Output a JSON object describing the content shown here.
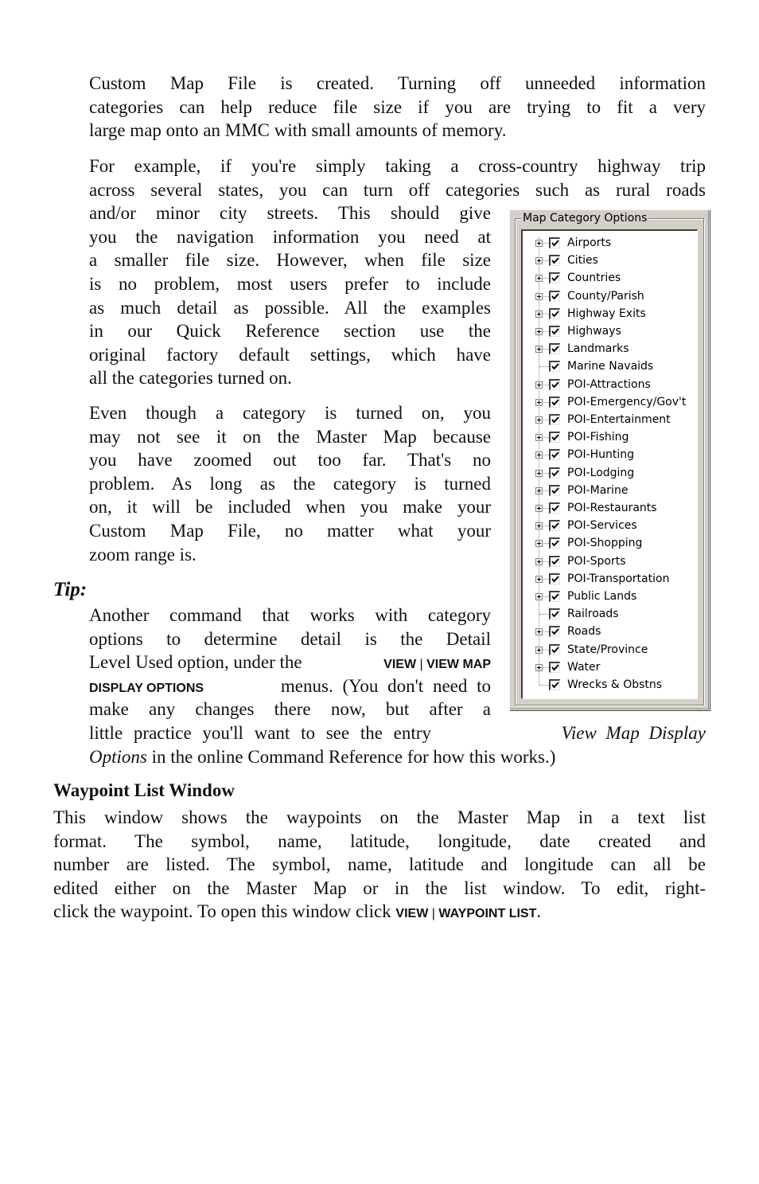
{
  "paragraph1": {
    "lines": [
      "Custom Map File is created. Turning off unneeded information",
      "categories can help reduce file size if you are trying to fit a very",
      "large map onto an MMC with small amounts of memory."
    ]
  },
  "paragraph2": {
    "lines": [
      "For example, if you're simply taking a cross-country highway trip",
      "across several states, you can turn off categories such as rural roads",
      "and/or minor city streets. This should give",
      "you the navigation information you need at",
      "a smaller file size. However, when file size",
      "is no problem, most users prefer to include",
      "as much detail as possible. All the examples",
      "in our Quick Reference section use the",
      "original factory default settings, which have",
      "all the categories turned on."
    ]
  },
  "paragraph3": {
    "lines": [
      "Even though a category is turned on, you",
      "may not see it on the Master Map because",
      "you have zoomed out too far. That's no",
      "problem. As long as the category is turned",
      "on, it will be included when you make your",
      "Custom Map File, no matter what  your",
      "zoom range is."
    ]
  },
  "tip": {
    "label": "Tip:",
    "line1": "Another command that works with category",
    "line2": "options to determine detail is the Detail",
    "line3_prefix": "Level Used option, under the ",
    "menu_view": "View",
    "menu_sep": "|",
    "menu_view_map": "View Map",
    "menu_display_options": "Display Options",
    "line4_suffix": " menus. (You don't need to",
    "line5": "make any changes there now, but after a",
    "line6_prefix": "little practice you'll want to see the entry ",
    "line6_italic": "View Map Display",
    "line7_italic": "Options",
    "line7_suffix": " in the online Command Reference for how this works.)"
  },
  "waypoint_section": {
    "heading": "Waypoint List Window",
    "lines": [
      "This window shows the waypoints on the Master Map in a text list",
      "format. The symbol, name, latitude, longitude, date created and",
      "number are listed. The symbol, name, latitude and longitude can all be",
      "edited either on the Master Map or in the list window. To edit, right-"
    ],
    "last_line_prefix": "click the waypoint. To open this window click ",
    "menu_view": "View",
    "menu_sep": "|",
    "menu_waypoint_list": "Waypoint List",
    "last_line_suffix": "."
  },
  "map_category_options": {
    "title": "Map Category Options",
    "items": [
      {
        "label": "Airports",
        "checked": true,
        "expandable": true
      },
      {
        "label": "Cities",
        "checked": true,
        "expandable": true
      },
      {
        "label": "Countries",
        "checked": true,
        "expandable": true
      },
      {
        "label": "County/Parish",
        "checked": true,
        "expandable": true
      },
      {
        "label": "Highway Exits",
        "checked": true,
        "expandable": true
      },
      {
        "label": "Highways",
        "checked": true,
        "expandable": true
      },
      {
        "label": "Landmarks",
        "checked": true,
        "expandable": true
      },
      {
        "label": "Marine Navaids",
        "checked": true,
        "expandable": false
      },
      {
        "label": "POI-Attractions",
        "checked": true,
        "expandable": true
      },
      {
        "label": "POI-Emergency/Gov't",
        "checked": true,
        "expandable": true
      },
      {
        "label": "POI-Entertainment",
        "checked": true,
        "expandable": true
      },
      {
        "label": "POI-Fishing",
        "checked": true,
        "expandable": true
      },
      {
        "label": "POI-Hunting",
        "checked": true,
        "expandable": true
      },
      {
        "label": "POI-Lodging",
        "checked": true,
        "expandable": true
      },
      {
        "label": "POI-Marine",
        "checked": true,
        "expandable": true
      },
      {
        "label": "POI-Restaurants",
        "checked": true,
        "expandable": true
      },
      {
        "label": "POI-Services",
        "checked": true,
        "expandable": true
      },
      {
        "label": "POI-Shopping",
        "checked": true,
        "expandable": true
      },
      {
        "label": "POI-Sports",
        "checked": true,
        "expandable": true
      },
      {
        "label": "POI-Transportation",
        "checked": true,
        "expandable": true
      },
      {
        "label": "Public Lands",
        "checked": true,
        "expandable": true
      },
      {
        "label": "Railroads",
        "checked": true,
        "expandable": false
      },
      {
        "label": "Roads",
        "checked": true,
        "expandable": true
      },
      {
        "label": "State/Province",
        "checked": true,
        "expandable": true
      },
      {
        "label": "Water",
        "checked": true,
        "expandable": true
      },
      {
        "label": "Wrecks & Obstns",
        "checked": true,
        "expandable": false
      }
    ]
  }
}
